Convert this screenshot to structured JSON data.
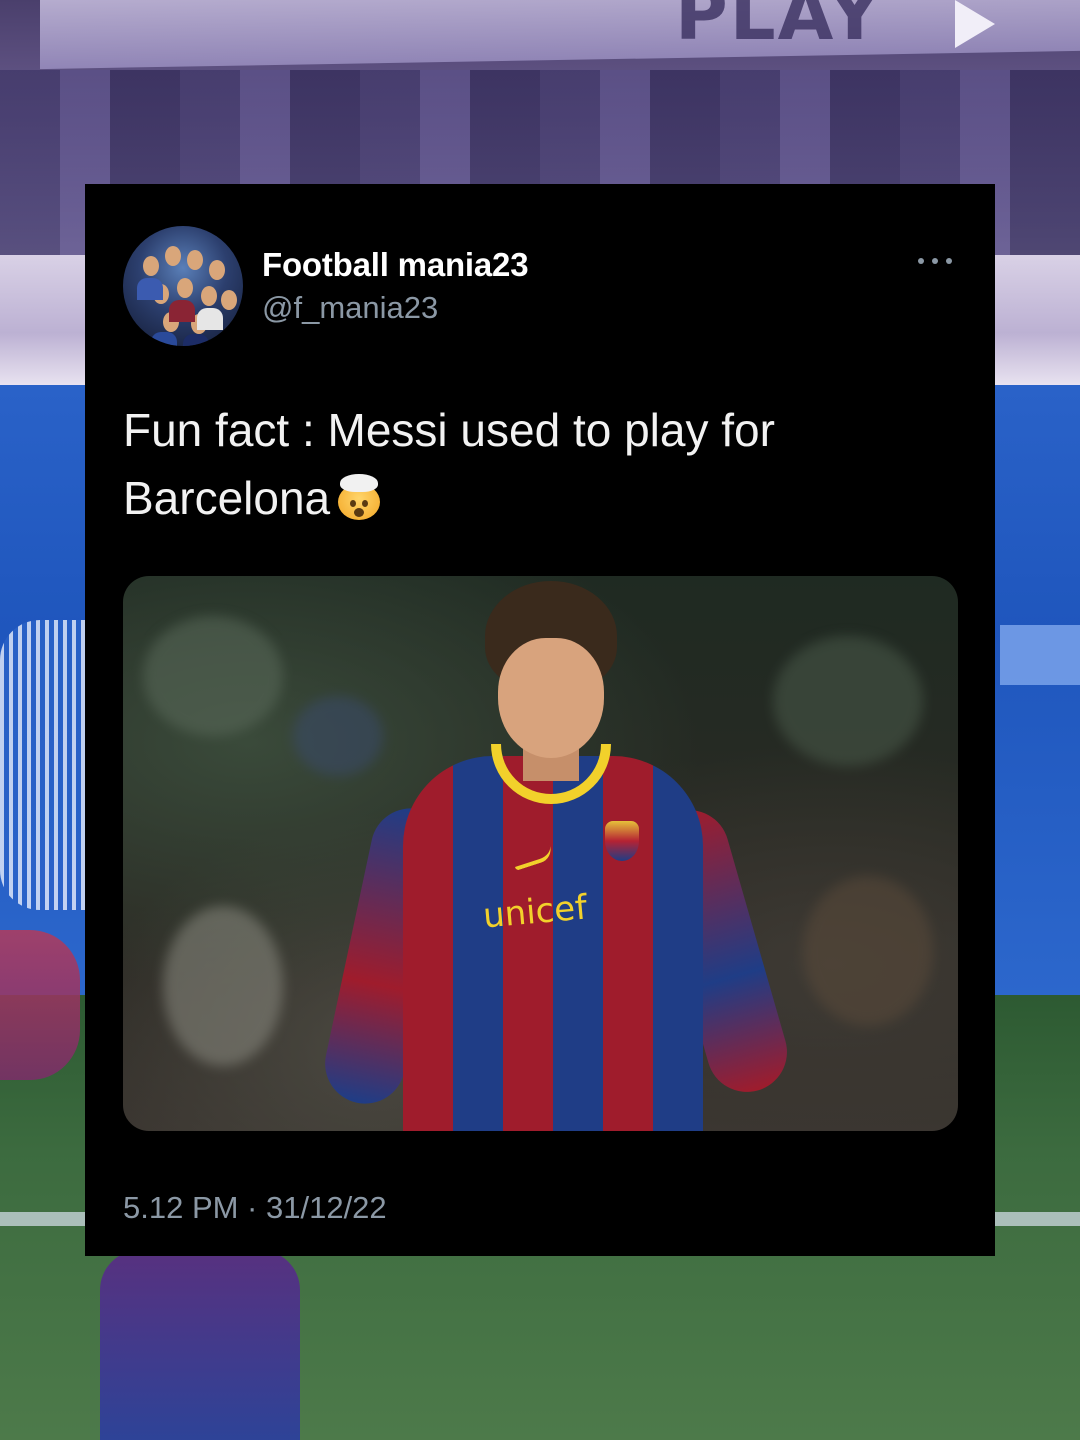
{
  "tweet": {
    "display_name": "Football mania23",
    "handle": "@f_mania23",
    "text": "Fun fact : Messi used to play for\nBarcelona",
    "emoji": "🤯",
    "timestamp": "5.12 PM · 31/12/22",
    "media": {
      "sponsor_text": "unicef"
    }
  },
  "background": {
    "banner_text": "PLAY"
  },
  "icons": {
    "more": "more-options-icon",
    "emoji": "exploding-head-icon"
  },
  "colors": {
    "card_bg": "#000000",
    "name": "#ffffff",
    "secondary_text": "#8b98a5",
    "body_text": "#f2f2f2"
  }
}
